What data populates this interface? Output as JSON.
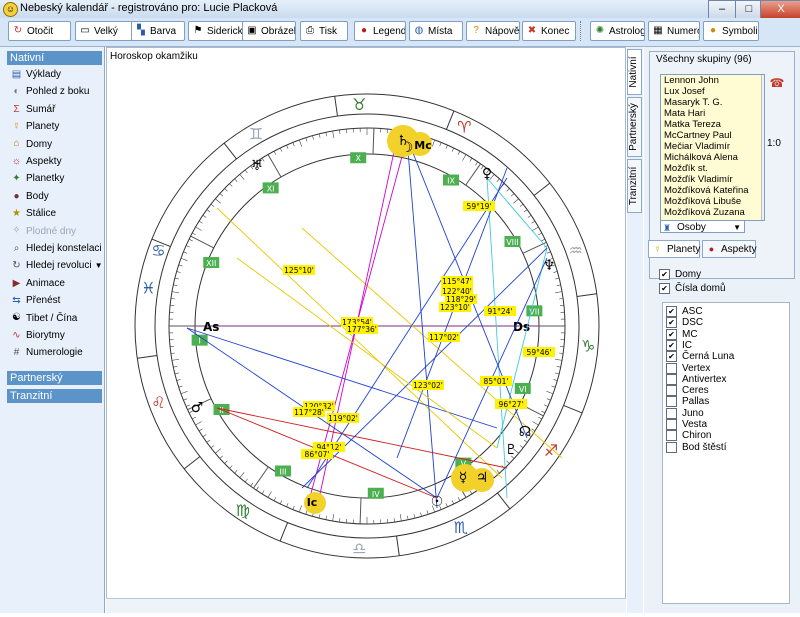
{
  "window": {
    "title": "Nebeský kalendář - registrováno pro: Lucie Placková",
    "minimize": "–",
    "maximize": "□",
    "close": "X"
  },
  "toolbar": {
    "buttons": [
      {
        "label": "Otočit",
        "icon": "rotate-icon"
      },
      {
        "label": "Velký",
        "icon": "monitor-icon"
      },
      {
        "label": "Barva",
        "icon": "palette-icon"
      },
      {
        "label": "Siderický",
        "icon": "flag-icon"
      },
      {
        "label": "Obrázek",
        "icon": "picture-icon"
      },
      {
        "label": "Tisk",
        "icon": "print-icon"
      },
      {
        "label": "Legenda",
        "icon": "legend-icon"
      },
      {
        "label": "Místa",
        "icon": "globe-icon"
      },
      {
        "label": "Nápověda",
        "icon": "help-icon"
      },
      {
        "label": "Konec",
        "icon": "exit-icon"
      }
    ],
    "extra": [
      {
        "label": "Astrologi...",
        "icon": "astro-icon"
      },
      {
        "label": "Numerol...",
        "icon": "numerology-icon"
      },
      {
        "label": "Symbolik...",
        "icon": "symbol-icon"
      }
    ]
  },
  "sidebar": {
    "section_native": "Nativní",
    "items": [
      {
        "label": "Výklady",
        "icon": "document-icon",
        "color": "#2a5ea8",
        "glyph": "▤"
      },
      {
        "label": "Pohled z boku",
        "icon": "planet-icon",
        "color": "#6c7a8a",
        "glyph": "◐"
      },
      {
        "label": "Sumář",
        "icon": "sum-icon",
        "color": "#c0392b",
        "glyph": "Σ"
      },
      {
        "label": "Planety",
        "icon": "planets-icon",
        "color": "#d99a00",
        "glyph": "☿"
      },
      {
        "label": "Domy",
        "icon": "houses-icon",
        "color": "#d06a00",
        "glyph": "⌂"
      },
      {
        "label": "Aspekty",
        "icon": "aspects-icon",
        "color": "#b11f1f",
        "glyph": "☼"
      },
      {
        "label": "Planetky",
        "icon": "asteroids-icon",
        "color": "#2f7d2f",
        "glyph": "✦"
      },
      {
        "label": "Body",
        "icon": "points-icon",
        "color": "#7a2f2f",
        "glyph": "●"
      },
      {
        "label": "Stálice",
        "icon": "fixed-stars-icon",
        "color": "#b38f00",
        "glyph": "★"
      },
      {
        "label": "Plodné dny",
        "icon": "fertility-icon",
        "color": "#9aa7b4",
        "glyph": "✧",
        "disabled": true
      },
      {
        "label": "Hledej konstelaci",
        "icon": "search-icon",
        "color": "#555555",
        "glyph": "⌕"
      },
      {
        "label": "Hledej revoluci",
        "icon": "revolution-icon",
        "color": "#555555",
        "glyph": "↻",
        "dropdown": "▼"
      },
      {
        "label": "Animace",
        "icon": "animation-icon",
        "color": "#8a2a2a",
        "glyph": "▶"
      },
      {
        "label": "Přenést",
        "icon": "transfer-icon",
        "color": "#2a5ea8",
        "glyph": "⇆"
      },
      {
        "label": "Tibet / Čína",
        "icon": "yin-yang-icon",
        "color": "#000000",
        "glyph": "☯"
      },
      {
        "label": "Biorytmy",
        "icon": "biorhythm-icon",
        "color": "#c0392b",
        "glyph": "∿"
      },
      {
        "label": "Numerologie",
        "icon": "numerology-icon",
        "color": "#555555",
        "glyph": "#"
      }
    ],
    "section_partner": "Partnerský",
    "section_transit": "Tranzitní"
  },
  "chart_caption": "Horoskop okamžiku",
  "chart_data": {
    "type": "diagram",
    "signs": [
      "♈",
      "♉",
      "♊",
      "♋",
      "♌",
      "♍",
      "♎",
      "♏",
      "♐",
      "♑",
      "♒",
      "♓"
    ],
    "houses": [
      "I",
      "II",
      "III",
      "IV",
      "V",
      "VI",
      "VII",
      "VIII",
      "IX",
      "X",
      "XI",
      "XII"
    ],
    "axes": {
      "asc": "As",
      "dsc": "Ds",
      "mc": "Mc",
      "ic": "Ic"
    },
    "aspect_labels": [
      "125°10'",
      "59°19'",
      "115°47'",
      "122°40'",
      "118°29'",
      "123°10'",
      "91°24'",
      "173°54'",
      "177°36'",
      "117°02'",
      "59°46'",
      "123°02'",
      "85°01'",
      "120°32'",
      "117°28'",
      "119°02'",
      "96°27'",
      "94°12'",
      "86°07'"
    ],
    "planet_glyphs": [
      "♄",
      "☽",
      "♅",
      "♆",
      "♀",
      "☉",
      "♂",
      "♇",
      "☿",
      "♃",
      "☊"
    ]
  },
  "rightpanel": {
    "vtabs": [
      "Nativní",
      "Partnerský",
      "Tranzitní"
    ],
    "group_label": "Všechny skupiny (96)",
    "people": [
      "Lennon John",
      "Lux Josef",
      "Masaryk T. G.",
      "Mata Hari",
      "Matka Tereza",
      "McCartney Paul",
      "Mečiar Vladimír",
      "Michálková Alena",
      "Možďík st.",
      "Možďík Vladimír",
      "Možďíková Kateřina",
      "Možďíková Libuše",
      "Možďíková Zuzana"
    ],
    "ratio": "1:0",
    "select_value": "Osoby",
    "tabs": [
      "Planety",
      "Aspekty"
    ],
    "checks_top": [
      {
        "label": "Domy",
        "checked": true
      },
      {
        "label": "Čísla domů",
        "checked": true
      }
    ],
    "checks": [
      {
        "label": "ASC",
        "checked": true
      },
      {
        "label": "DSC",
        "checked": true
      },
      {
        "label": "MC",
        "checked": true
      },
      {
        "label": "IC",
        "checked": true
      },
      {
        "label": "Černá Luna",
        "checked": true
      },
      {
        "label": "Vertex",
        "checked": false
      },
      {
        "label": "Antivertex",
        "checked": false
      },
      {
        "label": "Ceres",
        "checked": false
      },
      {
        "label": "Pallas",
        "checked": false
      },
      {
        "label": "Juno",
        "checked": false
      },
      {
        "label": "Vesta",
        "checked": false
      },
      {
        "label": "Chiron",
        "checked": false
      },
      {
        "label": "Bod štěstí",
        "checked": false
      }
    ]
  }
}
